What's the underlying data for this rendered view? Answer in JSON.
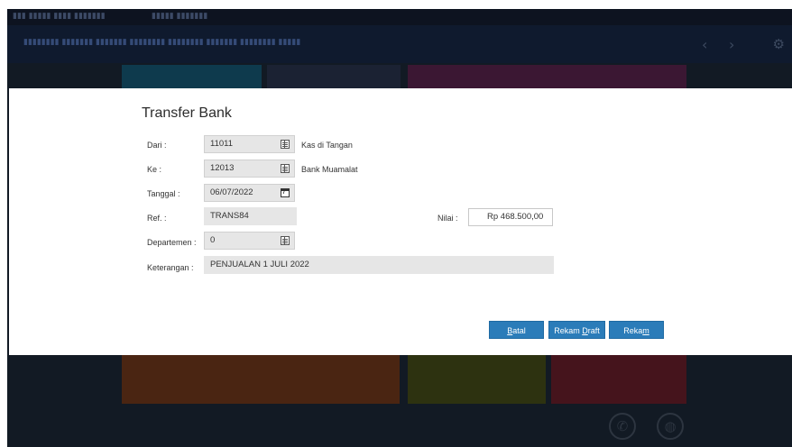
{
  "modal": {
    "title": "Transfer Bank",
    "dari": {
      "label": "Dari :",
      "value": "11011",
      "account_name": "Kas di Tangan"
    },
    "ke": {
      "label": "Ke :",
      "value": "12013",
      "account_name": "Bank Muamalat"
    },
    "tanggal": {
      "label": "Tanggal :",
      "value": "06/07/2022"
    },
    "ref": {
      "label": "Ref. :",
      "value": "TRANS84"
    },
    "departemen": {
      "label": "Departemen :",
      "value": "0"
    },
    "keterangan": {
      "label": "Keterangan :",
      "value": "PENJUALAN 1 JULI 2022"
    },
    "nilai": {
      "label": "Nilai :",
      "value": "Rp 468.500,00"
    },
    "buttons": {
      "batal": {
        "pre": "",
        "key": "B",
        "post": "atal"
      },
      "rekam_draft": {
        "pre": "Rekam ",
        "key": "D",
        "post": "raft"
      },
      "rekam": {
        "pre": "Reka",
        "key": "m",
        "post": ""
      }
    }
  },
  "colors": {
    "button_blue": "#2b7cb9",
    "field_grey": "#e6e6e6",
    "background_dark": "#121a24"
  },
  "icons": [
    "table-lookup-icon",
    "calendar-icon",
    "phone-icon",
    "globe-icon",
    "chevron-left-icon",
    "chevron-right-icon",
    "gear-icon"
  ]
}
